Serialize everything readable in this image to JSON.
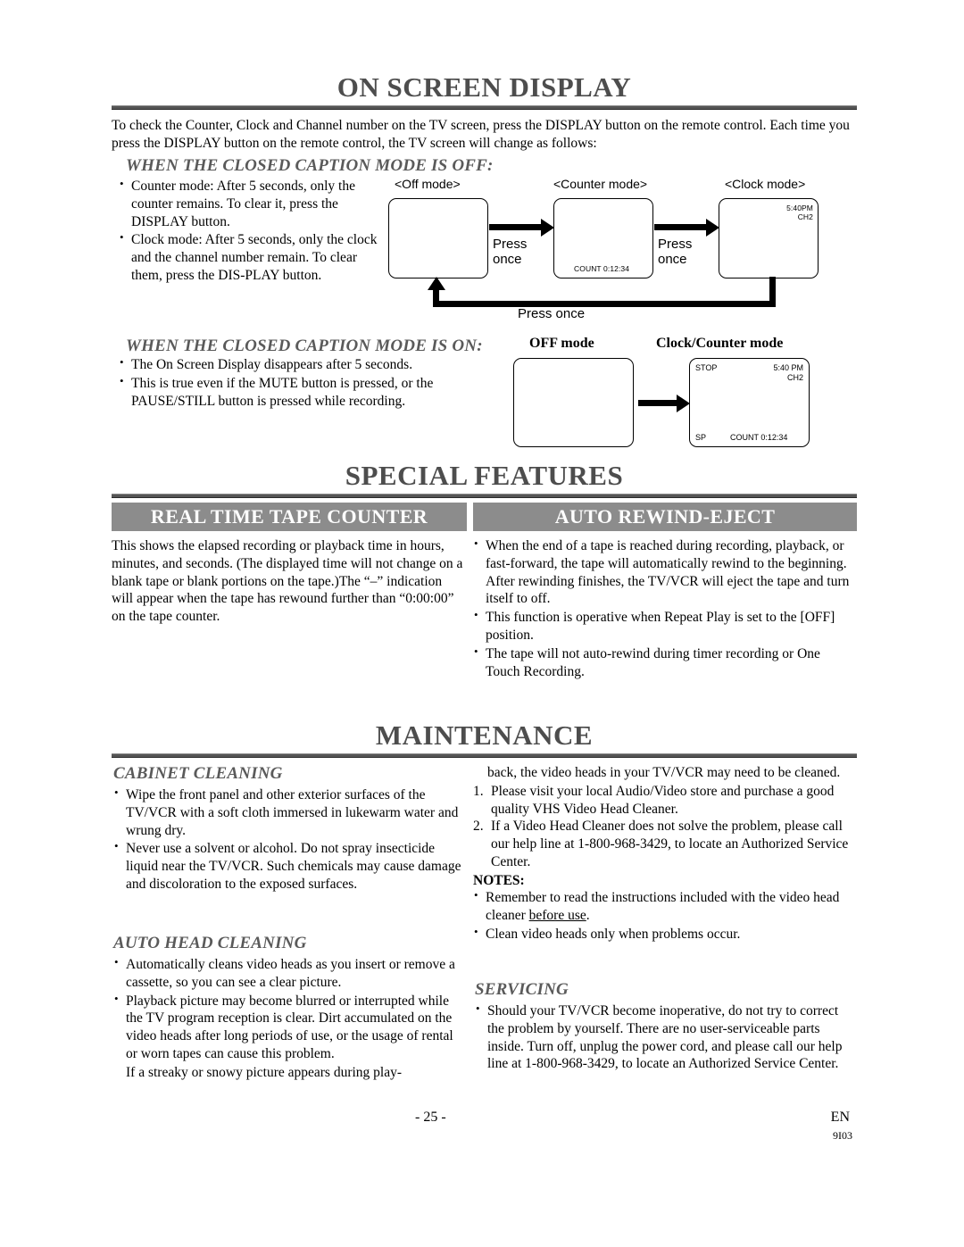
{
  "sections": {
    "on_screen_display": {
      "title": "ON SCREEN DISPLAY",
      "intro": "To check the Counter, Clock and Channel number on the TV screen, press the DISPLAY button on the remote control. Each time you press the DISPLAY button on the remote control, the TV screen will change as follows:",
      "sub_off": "WHEN THE CLOSED CAPTION MODE IS OFF:",
      "off_bullets": [
        "Counter mode: After 5 seconds, only the counter remains. To clear it, press the DISPLAY button.",
        "Clock mode: After 5 seconds, only the clock and the channel number remain. To clear them, press the DIS-PLAY button."
      ],
      "sub_on": "WHEN THE CLOSED CAPTION MODE IS ON:",
      "on_bullets": [
        "The On Screen Display disappears after 5 seconds.",
        "This is true even if the MUTE button is pressed, or the PAUSE/STILL button is pressed while recording."
      ]
    },
    "diagram1": {
      "label_off": "<Off mode>",
      "label_counter": "<Counter mode>",
      "label_clock": "<Clock mode>",
      "press1": "Press\nonce",
      "press2": "Press\nonce",
      "press3": "Press once",
      "counter_osd": "COUNT  0:12:34",
      "clock_osd_time": "5:40PM",
      "clock_osd_ch": "CH2"
    },
    "diagram2": {
      "label_off": "OFF mode",
      "label_clock_counter": "Clock/Counter mode",
      "osd_stop": "STOP",
      "osd_time": "5:40 PM",
      "osd_ch": "CH2",
      "osd_sp": "SP",
      "osd_count": "COUNT  0:12:34"
    },
    "special_features": {
      "title": "SPECIAL FEATURES",
      "ribbon_left": "REAL TIME TAPE COUNTER",
      "ribbon_right": "AUTO REWIND-EJECT",
      "tape_counter_text": "This shows the elapsed recording or playback time in hours, minutes, and seconds. (The displayed time will not change on a blank tape or blank portions on the tape.)The “–” indication will appear when the tape has rewound further than “0:00:00” on the tape counter.",
      "rewind_bullets": [
        "When the end of a tape is reached during recording, playback, or fast-forward, the tape will automatically rewind to the beginning. After rewinding finishes, the TV/VCR will eject the tape and turn itself to off.",
        "This function is operative when Repeat Play is set to the [OFF] position.",
        "The tape will not auto-rewind during timer recording or One Touch Recording."
      ]
    },
    "maintenance": {
      "title": "MAINTENANCE",
      "cabinet_cleaning": {
        "heading": "CABINET CLEANING",
        "bullets": [
          "Wipe the front panel and other exterior surfaces of the TV/VCR with a soft cloth immersed in lukewarm water and wrung dry.",
          "Never use a solvent or alcohol. Do not spray insecticide liquid near the TV/VCR. Such chemicals may cause damage and discoloration to the exposed surfaces."
        ]
      },
      "auto_head_cleaning": {
        "heading": "AUTO HEAD CLEANING",
        "bullets": [
          "Automatically cleans video heads as you insert or remove a cassette, so you can see a clear picture.",
          "Playback picture may become blurred or interrupted while the TV program reception is clear. Dirt accumulated on the video heads after long periods of use, or the usage of rental or worn tapes can cause this problem."
        ],
        "trailing": "If a streaky or snowy picture appears during play-"
      },
      "right_column": {
        "continuation": "back, the video heads in your TV/VCR may need to be cleaned.",
        "numbered": [
          "Please visit your local Audio/Video store and purchase a good quality VHS Video Head Cleaner.",
          "If a Video Head Cleaner does not solve the problem, please call our help line at 1-800-968-3429, to locate an Authorized Service Center."
        ],
        "notes_label": "NOTES:",
        "notes_bullets_pre": "Remember to read the instructions included with the video head cleaner ",
        "notes_bullets_underline": "before use",
        "notes_bullets_post": ".",
        "notes_bullet2": "Clean video heads only when problems occur."
      },
      "servicing": {
        "heading": "SERVICING",
        "bullets": [
          "Should your TV/VCR become inoperative, do not try to correct the problem by yourself. There are no user-serviceable parts inside. Turn off, unplug the power cord, and please call our help line at 1-800-968-3429, to locate an Authorized Service Center."
        ]
      }
    }
  },
  "footer": {
    "page_number": "- 25 -",
    "lang": "EN",
    "doc_code": "9I03"
  },
  "colors": {
    "ribbon_bg": "#8c8c8c",
    "rule": "#555555",
    "heading_gray": "#4d4d4d"
  }
}
